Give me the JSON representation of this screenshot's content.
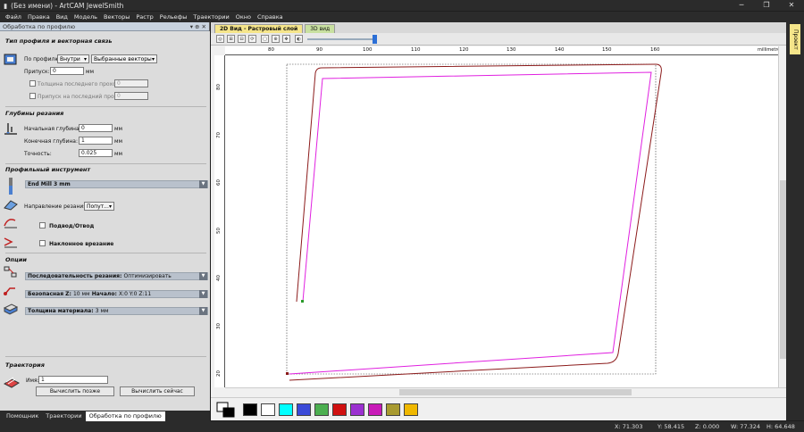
{
  "window": {
    "title": "(Без имени) - ArtCAM JewelSmith",
    "controls": [
      "─",
      "❐",
      "✕"
    ]
  },
  "menu": [
    "Файл",
    "Правка",
    "Вид",
    "Модель",
    "Векторы",
    "Растр",
    "Рельефы",
    "Траектории",
    "Окно",
    "Справка"
  ],
  "panel": {
    "title": "Обработка по профилю",
    "pin": "▾ ⊕ ✕",
    "profile_section": "Тип профиля и векторная связь",
    "by_profile_label": "По профилю",
    "by_profile_value": "Внутри",
    "vectors_value": "Выбранные векторы",
    "allowance_label": "Припуск:",
    "allowance_value": "0",
    "allowance_unit": "мм",
    "last_pass_thickness": "Толщина последнего прохода",
    "last_pass_thickness_value": "0",
    "last_pass_allowance": "Припуск на последний проход",
    "last_pass_allowance_value": "0",
    "depth_section": "Глубины резания",
    "start_depth_label": "Начальная глубина:",
    "start_depth_value": "0",
    "end_depth_label": "Конечная глубина:",
    "end_depth_value": "1",
    "tolerance_label": "Точность:",
    "tolerance_value": "0.025",
    "unit": "мм",
    "tool_section": "Профильный инструмент",
    "tool_name": "End Mill 3 mm",
    "direction_label": "Направление резания:",
    "direction_value": "Попут...",
    "lead_label": "Подвод/Отвод",
    "ramp_label": "Наклонное врезание",
    "options_section": "Опции",
    "order_label": "Последовательность резания:",
    "order_value": "Оптимизировать",
    "safe_z_label": "Безопасная Z:",
    "safe_z_value": "10 мм",
    "home_label": "Начало:",
    "home_value": "X:0 Y:0 Z:11",
    "material_label": "Толщина материала:",
    "material_value": "3 мм",
    "toolpath_section": "Траектория",
    "name_label": "Имя:",
    "name_value": "1",
    "calc_later": "Вычислить позже",
    "calc_now": "Вычислить сейчас",
    "expand_glyph": "▼"
  },
  "bottom_tabs": [
    {
      "label": "Помощник",
      "active": false
    },
    {
      "label": "Траектории",
      "active": false
    },
    {
      "label": "Обработка по профилю",
      "active": true
    }
  ],
  "view_tabs": [
    {
      "label": "2D Вид - Растровый слой",
      "active": true
    },
    {
      "label": "3D вид",
      "active": false
    }
  ],
  "toolbar_glyphs": [
    "◎",
    "⊞",
    "⊟",
    "⟳",
    "▢",
    "⊕",
    "✥",
    "◐"
  ],
  "ruler": {
    "x_ticks": [
      "80",
      "90",
      "100",
      "110",
      "120",
      "130",
      "140",
      "150",
      "160"
    ],
    "y_ticks": [
      "80",
      "70",
      "60",
      "50",
      "40",
      "30",
      "20"
    ],
    "units": "millimetres"
  },
  "palette": [
    "#000000",
    "#ffffff",
    "#00ffff",
    "#3a4ad8",
    "#4caf50",
    "#d01010",
    "#9b30d0",
    "#c81ab8",
    "#a89a30",
    "#f0b800"
  ],
  "status": {
    "x": "X: 71.303",
    "y": "Y: 58.415",
    "z": "Z: 0.000",
    "w": "W: 77.324",
    "h": "H: 64.648"
  },
  "project_label": "Проект"
}
